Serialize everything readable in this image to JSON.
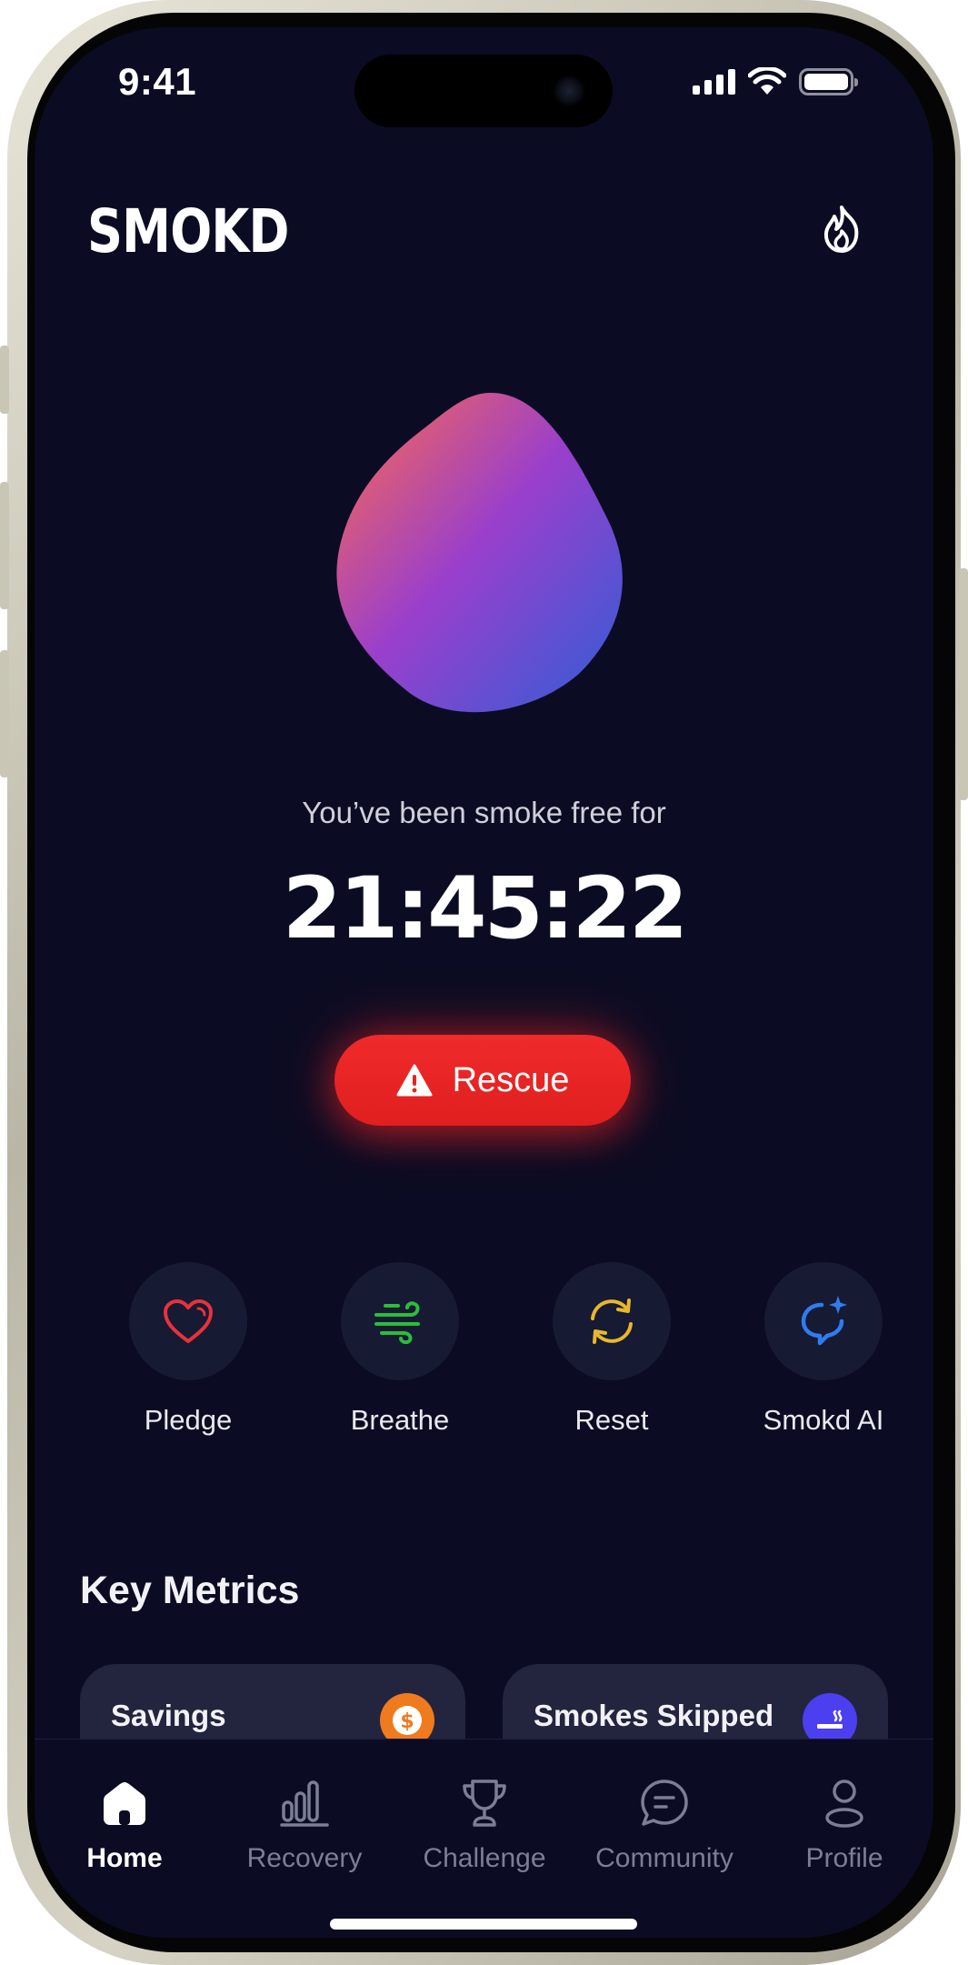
{
  "status_bar": {
    "time": "9:41"
  },
  "header": {
    "logo": "SMOKD",
    "streak_icon": "flame-icon"
  },
  "hero": {
    "subtitle": "You’ve been smoke free for",
    "timer": "21:45:22",
    "rescue_label": "Rescue",
    "rescue_icon": "warning-icon"
  },
  "quick_actions": [
    {
      "label": "Pledge",
      "icon": "heart-icon",
      "color": "#e8323a"
    },
    {
      "label": "Breathe",
      "icon": "wind-icon",
      "color": "#2bbd3a"
    },
    {
      "label": "Reset",
      "icon": "refresh-icon",
      "color": "#e8b72a"
    },
    {
      "label": "Smokd AI",
      "icon": "ai-chat-icon",
      "color": "#2f7cf0"
    }
  ],
  "metrics": {
    "title": "Key Metrics",
    "cards": [
      {
        "label": "Savings",
        "icon": "dollar-icon",
        "badge_color": "#f07a1e"
      },
      {
        "label": "Smokes Skipped",
        "icon": "no-smoking-icon",
        "badge_color": "#4b3ff0"
      }
    ]
  },
  "tabbar": {
    "tabs": [
      {
        "label": "Home",
        "icon": "home-icon",
        "active": true
      },
      {
        "label": "Recovery",
        "icon": "bar-chart-icon",
        "active": false
      },
      {
        "label": "Challenge",
        "icon": "trophy-icon",
        "active": false
      },
      {
        "label": "Community",
        "icon": "chat-icon",
        "active": false
      },
      {
        "label": "Profile",
        "icon": "user-icon",
        "active": false
      }
    ]
  },
  "colors": {
    "background": "#0b0c23",
    "accent_red": "#e8231f",
    "card": "#23253f"
  }
}
